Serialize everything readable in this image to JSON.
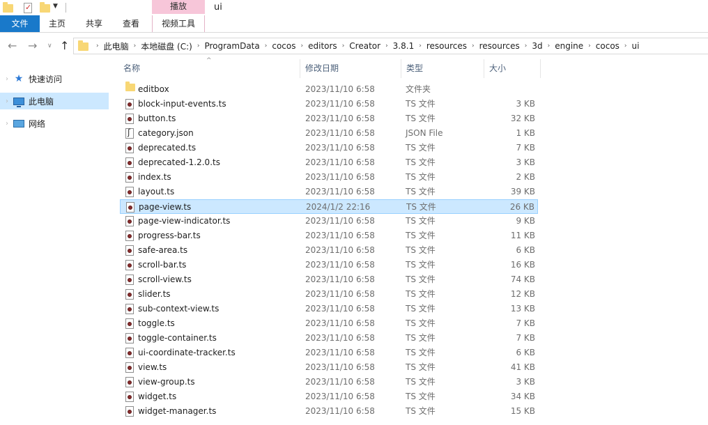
{
  "window": {
    "title": "ui",
    "context_tab": "播放"
  },
  "ribbon": {
    "tabs": [
      "文件",
      "主页",
      "共享",
      "查看",
      "视频工具"
    ]
  },
  "address": {
    "crumbs": [
      "此电脑",
      "本地磁盘 (C:)",
      "ProgramData",
      "cocos",
      "editors",
      "Creator",
      "3.8.1",
      "resources",
      "resources",
      "3d",
      "engine",
      "cocos",
      "ui"
    ]
  },
  "sidebar": {
    "items": [
      {
        "label": "快速访问",
        "icon": "star-icon"
      },
      {
        "label": "此电脑",
        "icon": "computer-icon",
        "selected": true
      },
      {
        "label": "网络",
        "icon": "network-icon"
      }
    ]
  },
  "columns": {
    "name": "名称",
    "date": "修改日期",
    "type": "类型",
    "size": "大小"
  },
  "files": [
    {
      "name": "editbox",
      "date": "2023/11/10 6:58",
      "type": "文件夹",
      "size": "",
      "icon": "folder-icon"
    },
    {
      "name": "block-input-events.ts",
      "date": "2023/11/10 6:58",
      "type": "TS 文件",
      "size": "3 KB",
      "icon": "ts-file-icon"
    },
    {
      "name": "button.ts",
      "date": "2023/11/10 6:58",
      "type": "TS 文件",
      "size": "32 KB",
      "icon": "ts-file-icon"
    },
    {
      "name": "category.json",
      "date": "2023/11/10 6:58",
      "type": "JSON File",
      "size": "1 KB",
      "icon": "json-file-icon"
    },
    {
      "name": "deprecated.ts",
      "date": "2023/11/10 6:58",
      "type": "TS 文件",
      "size": "7 KB",
      "icon": "ts-file-icon"
    },
    {
      "name": "deprecated-1.2.0.ts",
      "date": "2023/11/10 6:58",
      "type": "TS 文件",
      "size": "3 KB",
      "icon": "ts-file-icon"
    },
    {
      "name": "index.ts",
      "date": "2023/11/10 6:58",
      "type": "TS 文件",
      "size": "2 KB",
      "icon": "ts-file-icon"
    },
    {
      "name": "layout.ts",
      "date": "2023/11/10 6:58",
      "type": "TS 文件",
      "size": "39 KB",
      "icon": "ts-file-icon"
    },
    {
      "name": "page-view.ts",
      "date": "2024/1/2 22:16",
      "type": "TS 文件",
      "size": "26 KB",
      "icon": "ts-file-icon",
      "selected": true
    },
    {
      "name": "page-view-indicator.ts",
      "date": "2023/11/10 6:58",
      "type": "TS 文件",
      "size": "9 KB",
      "icon": "ts-file-icon"
    },
    {
      "name": "progress-bar.ts",
      "date": "2023/11/10 6:58",
      "type": "TS 文件",
      "size": "11 KB",
      "icon": "ts-file-icon"
    },
    {
      "name": "safe-area.ts",
      "date": "2023/11/10 6:58",
      "type": "TS 文件",
      "size": "6 KB",
      "icon": "ts-file-icon"
    },
    {
      "name": "scroll-bar.ts",
      "date": "2023/11/10 6:58",
      "type": "TS 文件",
      "size": "16 KB",
      "icon": "ts-file-icon"
    },
    {
      "name": "scroll-view.ts",
      "date": "2023/11/10 6:58",
      "type": "TS 文件",
      "size": "74 KB",
      "icon": "ts-file-icon"
    },
    {
      "name": "slider.ts",
      "date": "2023/11/10 6:58",
      "type": "TS 文件",
      "size": "12 KB",
      "icon": "ts-file-icon"
    },
    {
      "name": "sub-context-view.ts",
      "date": "2023/11/10 6:58",
      "type": "TS 文件",
      "size": "13 KB",
      "icon": "ts-file-icon"
    },
    {
      "name": "toggle.ts",
      "date": "2023/11/10 6:58",
      "type": "TS 文件",
      "size": "7 KB",
      "icon": "ts-file-icon"
    },
    {
      "name": "toggle-container.ts",
      "date": "2023/11/10 6:58",
      "type": "TS 文件",
      "size": "7 KB",
      "icon": "ts-file-icon"
    },
    {
      "name": "ui-coordinate-tracker.ts",
      "date": "2023/11/10 6:58",
      "type": "TS 文件",
      "size": "6 KB",
      "icon": "ts-file-icon"
    },
    {
      "name": "view.ts",
      "date": "2023/11/10 6:58",
      "type": "TS 文件",
      "size": "41 KB",
      "icon": "ts-file-icon"
    },
    {
      "name": "view-group.ts",
      "date": "2023/11/10 6:58",
      "type": "TS 文件",
      "size": "3 KB",
      "icon": "ts-file-icon"
    },
    {
      "name": "widget.ts",
      "date": "2023/11/10 6:58",
      "type": "TS 文件",
      "size": "34 KB",
      "icon": "ts-file-icon"
    },
    {
      "name": "widget-manager.ts",
      "date": "2023/11/10 6:58",
      "type": "TS 文件",
      "size": "15 KB",
      "icon": "ts-file-icon"
    }
  ],
  "colors": {
    "accent": "#1979ca",
    "selection": "#cce8ff",
    "selection_border": "#99d1ff",
    "context_tab": "#f7c6d9"
  }
}
